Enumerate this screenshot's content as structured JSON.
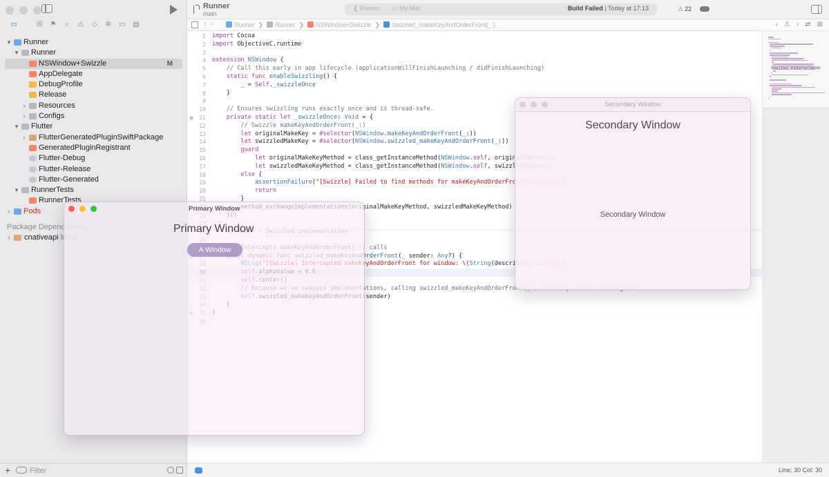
{
  "app": {
    "project_name": "Runner",
    "branch": "main",
    "scheme": "Runner",
    "destination": "My Mac",
    "build_status": "Build Failed",
    "build_time": "Today at 17:13",
    "warning_count": "22"
  },
  "navigator": {
    "items": [
      {
        "label": "Runner",
        "depth": 0,
        "chevron": "▾",
        "icon": "proj"
      },
      {
        "label": "Runner",
        "depth": 1,
        "chevron": "▾",
        "icon": "folder"
      },
      {
        "label": "NSWindow+Swizzle",
        "depth": 2,
        "chevron": "",
        "icon": "swift",
        "badge": "M",
        "selected": true
      },
      {
        "label": "AppDelegate",
        "depth": 2,
        "chevron": "",
        "icon": "swift"
      },
      {
        "label": "DebugProfile",
        "depth": 2,
        "chevron": "",
        "icon": "plist"
      },
      {
        "label": "Release",
        "depth": 2,
        "chevron": "",
        "icon": "plist"
      },
      {
        "label": "Resources",
        "depth": 2,
        "chevron": "›",
        "icon": "folder"
      },
      {
        "label": "Configs",
        "depth": 2,
        "chevron": "›",
        "icon": "folder"
      },
      {
        "label": "Flutter",
        "depth": 1,
        "chevron": "▾",
        "icon": "folder"
      },
      {
        "label": "FlutterGeneratedPluginSwiftPackage",
        "depth": 2,
        "chevron": "›",
        "icon": "pkg"
      },
      {
        "label": "GeneratedPluginRegistrant",
        "depth": 2,
        "chevron": "",
        "icon": "swift"
      },
      {
        "label": "Flutter-Debug",
        "depth": 2,
        "chevron": "",
        "icon": "xcconf"
      },
      {
        "label": "Flutter-Release",
        "depth": 2,
        "chevron": "",
        "icon": "xcconf"
      },
      {
        "label": "Flutter-Generated",
        "depth": 2,
        "chevron": "",
        "icon": "xcconf"
      },
      {
        "label": "RunnerTests",
        "depth": 1,
        "chevron": "▾",
        "icon": "folder"
      },
      {
        "label": "RunnerTests",
        "depth": 2,
        "chevron": "",
        "icon": "swift"
      },
      {
        "label": "Pods",
        "depth": 0,
        "chevron": "›",
        "icon": "proj",
        "red": true
      }
    ],
    "package_header": "Package Dependencies",
    "package_item": "cnativeapi",
    "package_item_suffix": "local",
    "filter_placeholder": "Filter"
  },
  "jumpbar": {
    "crumbs": [
      "Runner",
      "Runner",
      "NSWindow+Swizzle",
      "swizzled_makeKeyAndOrderFront(_:)"
    ]
  },
  "editor": {
    "current_line": 30,
    "lines": [
      {
        "n": 1,
        "html": "<span class=\"kw\">import</span> Cocoa"
      },
      {
        "n": 2,
        "html": "<span class=\"kw\">import</span> ObjectiveC.runtime"
      },
      {
        "n": 3,
        "html": ""
      },
      {
        "n": 4,
        "html": "<span class=\"kw\">extension</span> <span class=\"ty\">NSWindow</span> {"
      },
      {
        "n": 5,
        "html": "    <span class=\"cm\">// Call this early in app lifecycle (applicationWillFinishLaunching / didFinishLaunching)</span>"
      },
      {
        "n": 6,
        "html": "    <span class=\"kw\">static func</span> <span class=\"fn\">enableSwizzling</span>() {"
      },
      {
        "n": 7,
        "html": "        _ = <span class=\"kw\">Self</span>.<span class=\"fn\">_swizzleOnce</span>"
      },
      {
        "n": 8,
        "html": "    }"
      },
      {
        "n": 9,
        "html": ""
      },
      {
        "n": 10,
        "html": "    <span class=\"cm\">// Ensures swizzling runs exactly once and is thread-safe.</span>"
      },
      {
        "n": 11,
        "html": "    <span class=\"kw\">private static let</span> <span class=\"fn\">_swizzleOnce</span>: <span class=\"ty\">Void</span> = {"
      },
      {
        "n": 12,
        "html": "        <span class=\"cm\">// Swizzle makeKeyAndOrderFront(_:)</span>"
      },
      {
        "n": 13,
        "html": "        <span class=\"kw\">let</span> originalMakeKey = <span class=\"kw\">#selector</span>(<span class=\"ty\">NSWindow</span>.<span class=\"fn\">makeKeyAndOrderFront</span>(_:))"
      },
      {
        "n": 14,
        "html": "        <span class=\"kw\">let</span> swizzledMakeKey = <span class=\"kw\">#selector</span>(<span class=\"ty\">NSWindow</span>.<span class=\"fn\">swizzled_makeKeyAndOrderFront</span>(_:))"
      },
      {
        "n": 15,
        "html": "        <span class=\"kw\">guard</span>"
      },
      {
        "n": 16,
        "html": "            <span class=\"kw\">let</span> originalMakeKeyMethod = class_getInstanceMethod(<span class=\"ty\">NSWindow</span>.<span class=\"kw\">self</span>, originalMakeKey),"
      },
      {
        "n": 17,
        "html": "            <span class=\"kw\">let</span> swizzledMakeKeyMethod = class_getInstanceMethod(<span class=\"ty\">NSWindow</span>.<span class=\"kw\">self</span>, swizzledMakeKey)"
      },
      {
        "n": 18,
        "html": "        <span class=\"kw\">else</span> {"
      },
      {
        "n": 19,
        "html": "            <span class=\"fn\">assertionFailure</span>(<span class=\"st\">\"[Swizzle] Failed to find methods for makeKeyAndOrderFront swizzling\"</span>)"
      },
      {
        "n": 20,
        "html": "            <span class=\"kw\">return</span>"
      },
      {
        "n": 21,
        "html": "        }"
      },
      {
        "n": 22,
        "html": "        method_exchangeImplementations(originalMakeKeyMethod, swizzledMakeKeyMethod)"
      },
      {
        "n": 23,
        "html": "    }()"
      },
      {
        "n": 24,
        "html": ""
      },
      {
        "n": 25,
        "html": "    <span class=\"cm\">// MARK: - Swizzled implementation</span>"
      },
      {
        "n": 26,
        "html": ""
      },
      {
        "n": 27,
        "html": "    <span class=\"cm\">/// Intercepts makeKeyAndOrderFront(_:) calls</span>"
      },
      {
        "n": 28,
        "html": "    <span class=\"kw\">@objc dynamic func</span> <span class=\"fn\">swizzled_makeKeyAndOrderFront</span>(_ sender: <span class=\"ty\">Any</span>?) {"
      },
      {
        "n": 29,
        "html": "        <span class=\"fn\">NSLog</span>(<span class=\"st\">\"[Swizzle] Intercepted makeKeyAndOrderFront for window: \\(</span><span class=\"ty\">String</span>(describing: <span class=\"kw\">self</span>)<span class=\"st\">)\"</span>)"
      },
      {
        "n": 30,
        "html": "        <span class=\"kw\">self</span>.alphaValue = 0.6"
      },
      {
        "n": 31,
        "html": "        <span class=\"kw\">self</span>.center()"
      },
      {
        "n": 32,
        "html": "        <span class=\"cm\">// Because we've swapped implementations, calling swizzled_makeKeyAndOrderFront(_:) actually calls the original</span>"
      },
      {
        "n": 33,
        "html": "        <span class=\"kw\">self</span>.swizzled_makeKeyAndOrderFront(sender)"
      },
      {
        "n": 34,
        "html": "    }"
      },
      {
        "n": 35,
        "html": "}"
      },
      {
        "n": 36,
        "html": ""
      }
    ]
  },
  "minimap": {
    "mark_label": "Swizzled implementation"
  },
  "statusbar": {
    "position": "Line: 30  Col: 30"
  },
  "primary_window": {
    "title": "Primary Window",
    "heading": "Primary Window",
    "button_label": "A Window"
  },
  "secondary_window": {
    "title": "Secondary Window",
    "heading": "Secondary Window",
    "body_text": "Secondary Window"
  }
}
